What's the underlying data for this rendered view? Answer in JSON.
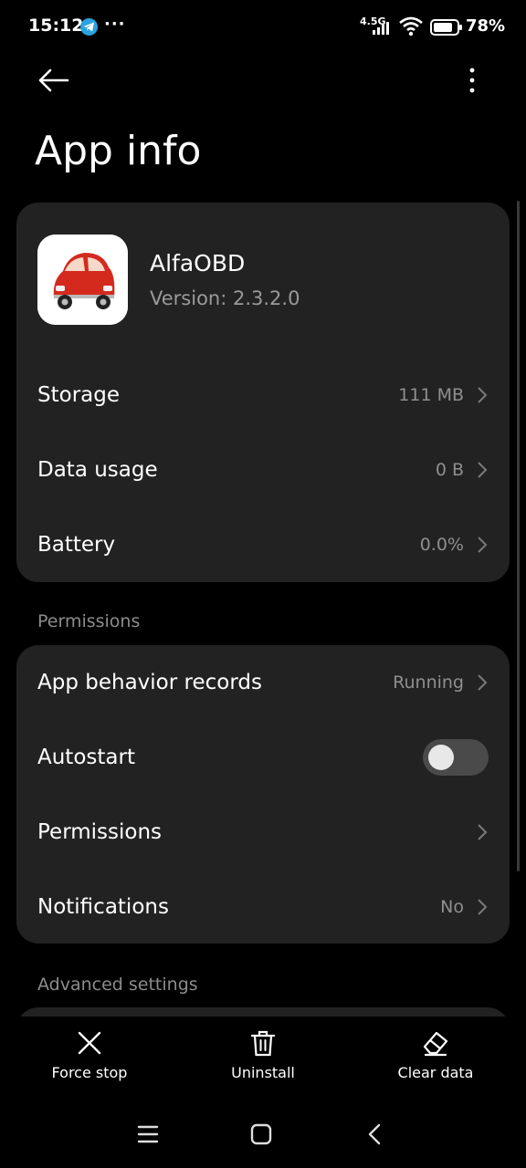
{
  "status_bar": {
    "time": "15:12",
    "network_type": "4.5G",
    "battery_percent": "78%",
    "icons": [
      "telegram-icon",
      "more-dots-icon",
      "signal-icon",
      "wifi-icon",
      "battery-icon"
    ]
  },
  "header": {
    "title": "App info"
  },
  "app": {
    "name": "AlfaOBD",
    "version": "Version: 2.3.2.0"
  },
  "usage_rows": [
    {
      "label": "Storage",
      "value": "111 MB"
    },
    {
      "label": "Data usage",
      "value": "0 B"
    },
    {
      "label": "Battery",
      "value": "0.0%"
    }
  ],
  "permissions_section": {
    "title": "Permissions",
    "rows": [
      {
        "label": "App behavior records",
        "value": "Running"
      },
      {
        "label": "Autostart",
        "toggle_on": false
      },
      {
        "label": "Permissions",
        "value": ""
      },
      {
        "label": "Notifications",
        "value": "No"
      }
    ]
  },
  "advanced_section": {
    "title": "Advanced settings"
  },
  "actions": {
    "force_stop": "Force stop",
    "uninstall": "Uninstall",
    "clear_data": "Clear data"
  },
  "colors": {
    "background": "#000000",
    "card": "#222222",
    "secondary_text": "#8f8f8f",
    "telegram": "#2AA3DE"
  }
}
